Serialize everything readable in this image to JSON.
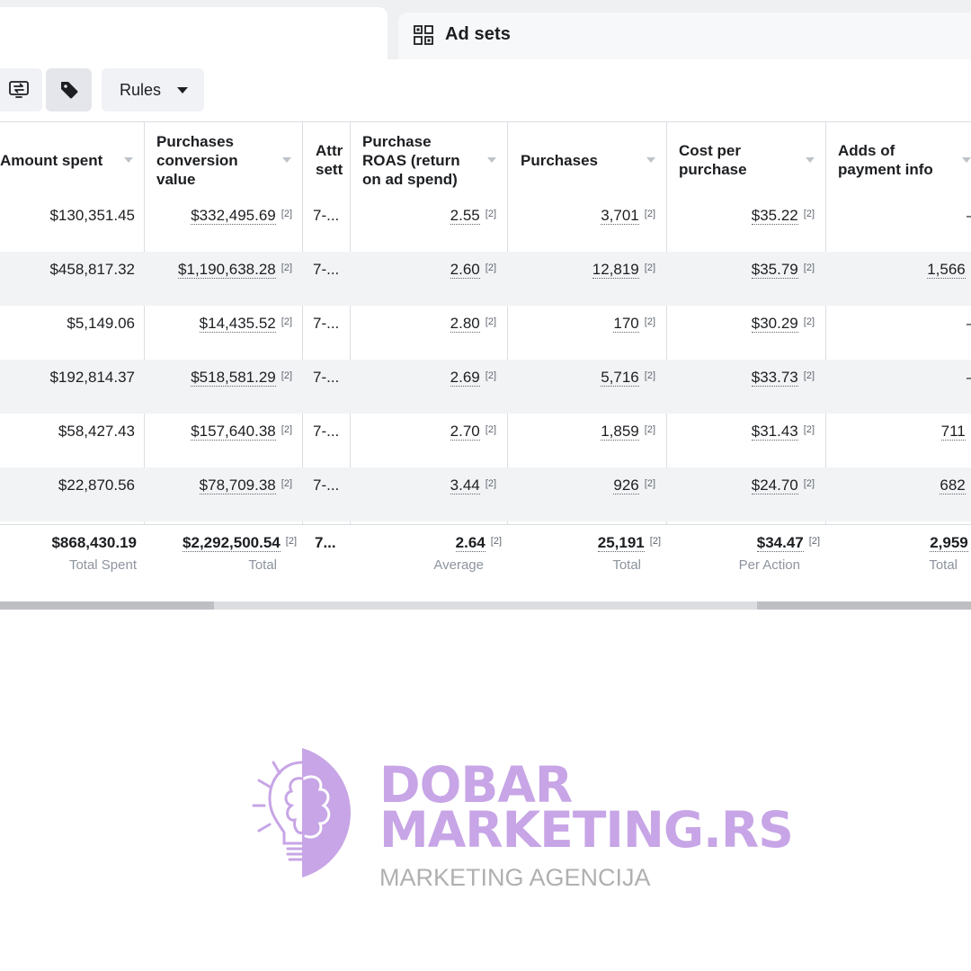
{
  "tabs": {
    "adsets_label": "Ad sets"
  },
  "toolbar": {
    "rules_label": "Rules"
  },
  "table": {
    "headers": {
      "amount_spent": "Amount spent",
      "purchases_value": "Purchases\nconversion\nvalue",
      "attribution": "Attr\nsett",
      "roas": "Purchase\nROAS (return\non ad spend)",
      "purchases": "Purchases",
      "cost_per_purchase": "Cost per\npurchase",
      "adds_payment": "Adds of\npayment info"
    },
    "rows": [
      {
        "spent": "$130,351.45",
        "value": "$332,495.69",
        "attr": "7-...",
        "roas": "2.55",
        "purchases": "3,701",
        "cpp": "$35.22",
        "adds": "—",
        "fn": "[2]"
      },
      {
        "spent": "$458,817.32",
        "value": "$1,190,638.28",
        "attr": "7-...",
        "roas": "2.60",
        "purchases": "12,819",
        "cpp": "$35.79",
        "adds": "1,566",
        "fn": "[2]"
      },
      {
        "spent": "$5,149.06",
        "value": "$14,435.52",
        "attr": "7-...",
        "roas": "2.80",
        "purchases": "170",
        "cpp": "$30.29",
        "adds": "—",
        "fn": "[2]"
      },
      {
        "spent": "$192,814.37",
        "value": "$518,581.29",
        "attr": "7-...",
        "roas": "2.69",
        "purchases": "5,716",
        "cpp": "$33.73",
        "adds": "—",
        "fn": "[2]"
      },
      {
        "spent": "$58,427.43",
        "value": "$157,640.38",
        "attr": "7-...",
        "roas": "2.70",
        "purchases": "1,859",
        "cpp": "$31.43",
        "adds": "711",
        "fn": "[2]"
      },
      {
        "spent": "$22,870.56",
        "value": "$78,709.38",
        "attr": "7-...",
        "roas": "3.44",
        "purchases": "926",
        "cpp": "$24.70",
        "adds": "682",
        "fn": "[2]"
      }
    ],
    "totals": {
      "spent": "$868,430.19",
      "spent_label": "Total Spent",
      "value": "$2,292,500.54",
      "value_label": "Total",
      "attr": "7...",
      "roas": "2.64",
      "roas_label": "Average",
      "purchases": "25,191",
      "purchases_label": "Total",
      "cpp": "$34.47",
      "cpp_label": "Per Action",
      "adds": "2,959",
      "adds_label": "Total",
      "fn": "[2]"
    }
  },
  "logo": {
    "line1": "DOBAR",
    "line2": "MARKETING.RS",
    "line3": "MARKETING AGENCIJA",
    "color": "#c7a5e6"
  },
  "icons": {
    "tab": "grid-icon",
    "toolbar_1": "swap-icon",
    "toolbar_2": "tag-icon",
    "logo": "lightbulb-brain-icon"
  }
}
